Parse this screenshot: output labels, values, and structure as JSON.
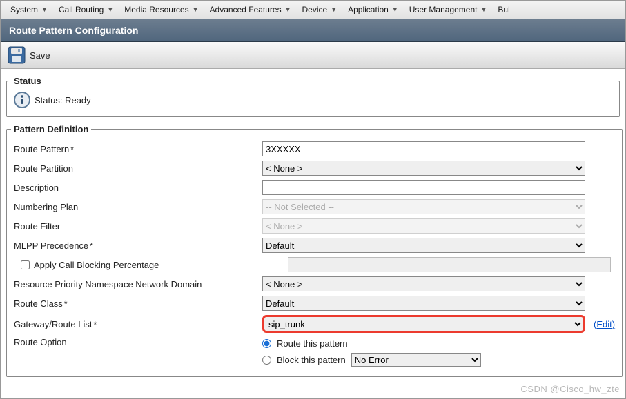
{
  "menu": {
    "items": [
      {
        "label": "System"
      },
      {
        "label": "Call Routing"
      },
      {
        "label": "Media Resources"
      },
      {
        "label": "Advanced Features"
      },
      {
        "label": "Device"
      },
      {
        "label": "Application"
      },
      {
        "label": "User Management"
      },
      {
        "label": "Bul"
      }
    ]
  },
  "title": "Route Pattern Configuration",
  "toolbar": {
    "save": "Save"
  },
  "status": {
    "legend": "Status",
    "text": "Status: Ready"
  },
  "pattern": {
    "legend": "Pattern Definition",
    "labels": {
      "route_pattern": "Route Pattern",
      "route_partition": "Route Partition",
      "description": "Description",
      "numbering_plan": "Numbering Plan",
      "route_filter": "Route Filter",
      "mlpp": "MLPP Precedence",
      "apply_cbp": "Apply Call Blocking Percentage",
      "rpnnd": "Resource Priority Namespace Network Domain",
      "route_class": "Route Class",
      "gw_rl": "Gateway/Route List",
      "route_option": "Route Option"
    },
    "values": {
      "route_pattern": "3XXXXX",
      "route_partition": "< None >",
      "description": "",
      "numbering_plan": "-- Not Selected --",
      "route_filter": "< None >",
      "mlpp": "Default",
      "rpnnd": "< None >",
      "route_class": "Default",
      "gw_rl": "sip_trunk",
      "block_sel": "No Error"
    },
    "radio": {
      "route_this": "Route this pattern",
      "block_this": "Block this pattern",
      "selected": "route_this"
    },
    "edit": "Edit"
  },
  "watermark": "CSDN @Cisco_hw_zte"
}
